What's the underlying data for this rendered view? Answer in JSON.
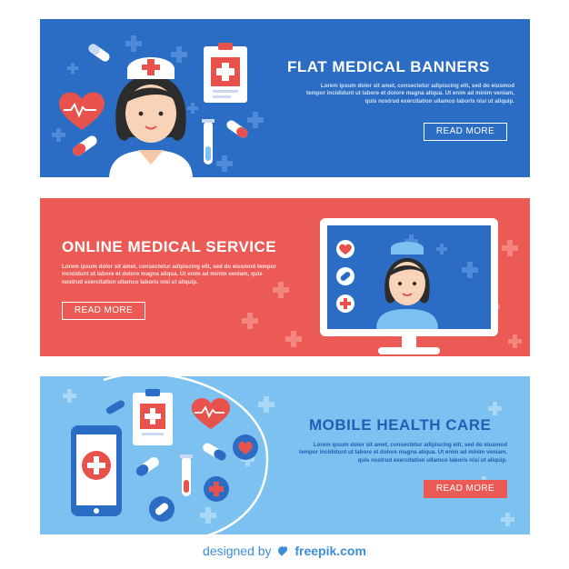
{
  "banners": [
    {
      "title": "FLAT MEDICAL BANNERS",
      "body": "Lorem ipsum dolor sit amet, consectetur adipiscing elit, sed do eiusmod tempor incididunt ut labore et dolore magna aliqua. Ut enim ad minim veniam, quis nostrud exercitation ullamco laboris nisi ut aliquip.",
      "button": "READ MORE",
      "background": "#2b6cc4"
    },
    {
      "title": "ONLINE MEDICAL SERVICE",
      "body": "Lorem ipsum dolor sit amet, consectetur adipiscing elit, sed do eiusmod tempor incididunt ut labore et dolore magna aliqua. Ut enim ad minim veniam, quis nostrud exercitation ullamco laboris nisi ut aliquip.",
      "button": "READ MORE",
      "background": "#ec5a55"
    },
    {
      "title": "MOBILE HEALTH CARE",
      "body": "Lorem ipsum dolor sit amet, consectetur adipiscing elit, sed do eiusmod tempor incididunt ut labore et dolore magna aliqua. Ut enim ad minim veniam, quis nostrud exercitation ullamco laboris nisi ut aliquip.",
      "button": "READ MORE",
      "background": "#7cc1ef"
    }
  ],
  "footer": {
    "prefix": "designed by",
    "brand": "freepik.com"
  },
  "colors": {
    "blue": "#2b6cc4",
    "red": "#ec5a55",
    "light_blue": "#7cc1ef",
    "footer_text": "#3b8fd8"
  },
  "icons": [
    "heart-icon",
    "pill-icon",
    "clipboard-icon",
    "test-tube-icon",
    "plus-icon",
    "monitor-icon",
    "smartphone-icon",
    "syringe-icon",
    "nurse-avatar",
    "freepik-logo-icon"
  ]
}
